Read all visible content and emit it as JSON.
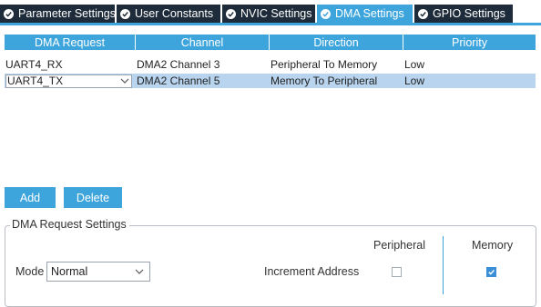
{
  "tabs": [
    {
      "label": "Parameter Settings",
      "active": false
    },
    {
      "label": "User Constants",
      "active": false
    },
    {
      "label": "NVIC Settings",
      "active": false
    },
    {
      "label": "DMA Settings",
      "active": true
    },
    {
      "label": "GPIO Settings",
      "active": false
    }
  ],
  "table": {
    "columns": [
      "DMA Request",
      "Channel",
      "Direction",
      "Priority"
    ],
    "rows": [
      {
        "request": "UART4_RX",
        "channel": "DMA2 Channel 3",
        "direction": "Peripheral To Memory",
        "priority": "Low",
        "selected": false
      },
      {
        "request": "UART4_TX",
        "channel": "DMA2 Channel 5",
        "direction": "Memory To Peripheral",
        "priority": "Low",
        "selected": true
      }
    ]
  },
  "buttons": {
    "add": "Add",
    "delete": "Delete"
  },
  "request_settings": {
    "title": "DMA Request Settings",
    "mode_label": "Mode",
    "mode_value": "Normal",
    "col_peripheral": "Peripheral",
    "col_memory": "Memory",
    "increment_label": "Increment Address",
    "increment_peripheral": false,
    "increment_memory": true
  },
  "colors": {
    "accent": "#3ea5dc",
    "tab_dark": "#1e2b3a",
    "selected_row": "#b8d4ee",
    "checkbox_on": "#3b8fd8"
  },
  "icons": {
    "tab": "check-circle-icon",
    "dropdown": "chevron-down-icon",
    "check": "checkmark-icon"
  }
}
